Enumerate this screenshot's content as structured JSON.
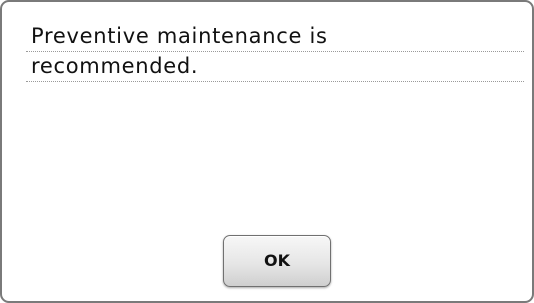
{
  "dialog": {
    "message_lines": [
      "Preventive maintenance is",
      "recommended."
    ],
    "ok_label": "OK"
  }
}
